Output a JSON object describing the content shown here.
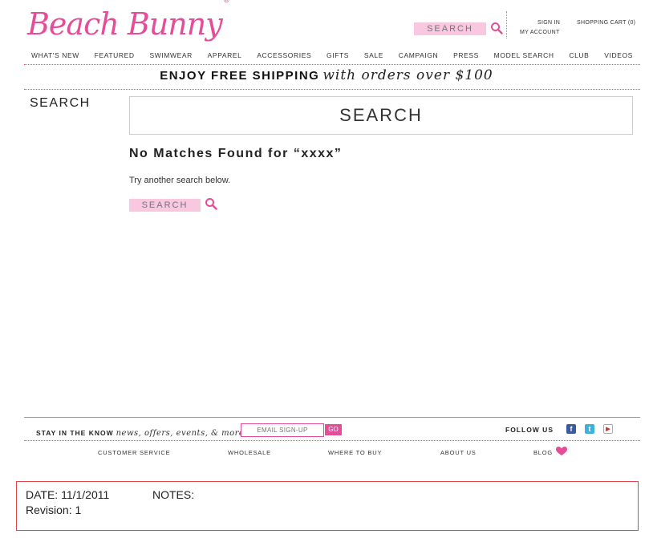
{
  "header": {
    "logo_text": "Beach Bunny",
    "logo_mark": "®",
    "search_placeholder": "SEARCH",
    "sign_in": "SIGN IN",
    "my_account": "MY ACCOUNT",
    "shopping_cart": "SHOPPING CART (0)"
  },
  "nav": {
    "items": [
      "WHAT'S NEW",
      "FEATURED",
      "SWIMWEAR",
      "APPAREL",
      "ACCESSORIES",
      "GIFTS",
      "SALE",
      "CAMPAIGN",
      "PRESS",
      "MODEL SEARCH",
      "CLUB",
      "VIDEOS"
    ]
  },
  "promo": {
    "bold": "ENJOY FREE SHIPPING",
    "script": "with orders over $100"
  },
  "main": {
    "sidebar_title": "SEARCH",
    "big_search_text": "SEARCH",
    "no_match": "No Matches Found for “xxxx”",
    "try_again": "Try another search below.",
    "search_placeholder": "SEARCH"
  },
  "footer": {
    "stay_bold": "STAY IN THE KNOW",
    "stay_script": "news, offers, events, & more",
    "email_placeholder": "EMAIL SIGN-UP",
    "go": "GO",
    "follow": "FOLLOW US",
    "links": [
      "CUSTOMER SERVICE",
      "WHOLESALE",
      "WHERE TO BUY",
      "ABOUT US",
      "BLOG"
    ]
  },
  "notes": {
    "date": "DATE: 11/1/2011",
    "notes_label": "NOTES:",
    "revision": "Revision: 1"
  },
  "colors": {
    "brand_pink": "#e54d98",
    "search_pink": "#f9c7df",
    "notes_border": "#e0454f"
  }
}
